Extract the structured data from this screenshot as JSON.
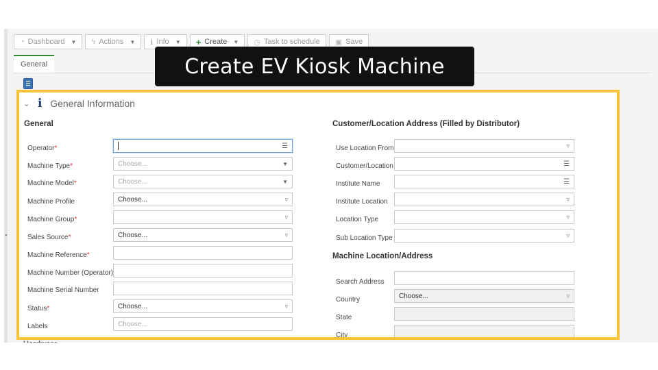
{
  "toolbar": {
    "dashboard": "Dashboard",
    "actions": "Actions",
    "info": "Info",
    "create": "Create",
    "task": "Task to schedule",
    "save": "Save"
  },
  "tabs": {
    "general": "General"
  },
  "banner": {
    "title": "Create EV Kiosk Machine"
  },
  "section": {
    "title": "General Information"
  },
  "left": {
    "group_title": "General",
    "fields": [
      {
        "label": "Operator",
        "required": "*",
        "value": "",
        "placeholder": "",
        "icon": "list-icon"
      },
      {
        "label": "Machine Type",
        "required": "*",
        "value": "",
        "placeholder": "Choose...",
        "icon": "caret-down-icon"
      },
      {
        "label": "Machine Model",
        "required": "*",
        "value": "",
        "placeholder": "Choose...",
        "icon": "caret-down-icon"
      },
      {
        "label": "Machine Profile",
        "required": "",
        "value": "Choose...",
        "placeholder": "",
        "icon": "triangle-down-icon"
      },
      {
        "label": "Machine Group",
        "required": "*",
        "value": "",
        "placeholder": "",
        "icon": "triangle-down-icon"
      },
      {
        "label": "Sales Source",
        "required": "*",
        "value": "Choose...",
        "placeholder": "",
        "icon": "triangle-down-icon"
      },
      {
        "label": "Machine Reference",
        "required": "*",
        "value": "",
        "placeholder": "",
        "icon": ""
      },
      {
        "label": "Machine Number (Operator)",
        "required": "",
        "value": "",
        "placeholder": "",
        "icon": ""
      },
      {
        "label": "Machine Serial Number",
        "required": "",
        "value": "",
        "placeholder": "",
        "icon": ""
      },
      {
        "label": "Status",
        "required": "*",
        "value": "Choose...",
        "placeholder": "",
        "icon": "triangle-down-icon"
      },
      {
        "label": "Labels",
        "required": "",
        "value": "",
        "placeholder": "Choose...",
        "icon": ""
      }
    ]
  },
  "right": {
    "group_title": "Customer/Location Address (Filled by Distributor)",
    "fields": [
      {
        "label": "Use Location From",
        "value": "",
        "icon": "triangle-down-icon"
      },
      {
        "label": "Customer/Location",
        "value": "",
        "icon": "list-icon"
      },
      {
        "label": "Institute Name",
        "value": "",
        "icon": "list-icon"
      },
      {
        "label": "Institute Location",
        "value": "",
        "icon": "triangle-down-icon"
      },
      {
        "label": "Location Type",
        "value": "",
        "icon": "triangle-down-icon"
      },
      {
        "label": "Sub Location Type",
        "value": "",
        "icon": "triangle-down-icon"
      }
    ],
    "group2_title": "Machine Location/Address",
    "fields2": [
      {
        "label": "Search Address",
        "value": "",
        "icon": ""
      },
      {
        "label": "Country",
        "value": "Choose...",
        "icon": "triangle-down-icon"
      },
      {
        "label": "State",
        "value": "",
        "icon": ""
      },
      {
        "label": "City",
        "value": "",
        "icon": ""
      }
    ]
  },
  "next_section": {
    "title": "Hardware"
  }
}
